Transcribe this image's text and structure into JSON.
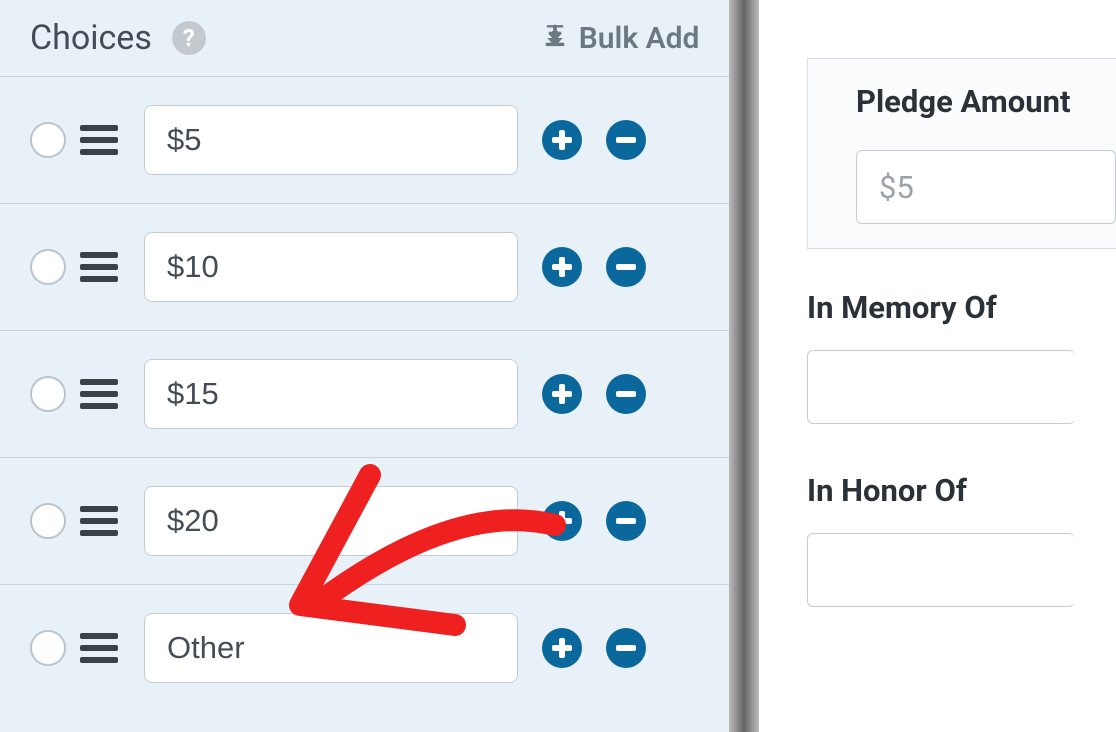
{
  "header": {
    "choices_title": "Choices",
    "bulk_add_label": "Bulk Add"
  },
  "choices": [
    {
      "value": "$5"
    },
    {
      "value": "$10"
    },
    {
      "value": "$15"
    },
    {
      "value": "$20"
    },
    {
      "value": "Other"
    }
  ],
  "preview": {
    "pledge_amount_label": "Pledge Amount",
    "pledge_amount_value": "$5",
    "in_memory_of_label": "In Memory Of",
    "in_honor_of_label": "In Honor Of"
  },
  "colors": {
    "button_blue": "#0a689c",
    "panel_bg": "#e9f1f8",
    "annotation_red": "#ef2020"
  }
}
